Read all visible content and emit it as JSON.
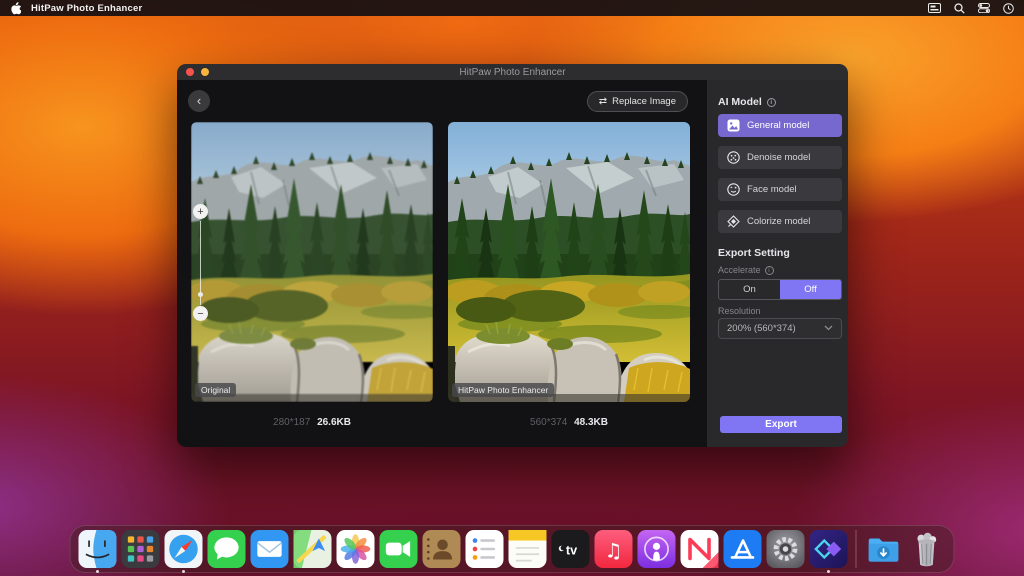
{
  "menu_bar": {
    "app_name": "HitPaw Photo Enhancer",
    "icons": [
      "apple-logo",
      "keyboard-icon",
      "search-icon",
      "control-center-icon",
      "clock-icon"
    ]
  },
  "window": {
    "title": "HitPaw Photo Enhancer",
    "toolbar": {
      "replace_image_label": "Replace Image"
    },
    "panels": {
      "original": {
        "tag": "Original",
        "dimensions": "280*187",
        "size": "26.6KB"
      },
      "enhanced": {
        "tag": "HitPaw Photo Enhancer",
        "dimensions": "560*374",
        "size": "48.3KB"
      }
    },
    "sidebar": {
      "ai_model_label": "AI Model",
      "models": [
        {
          "label": "General model",
          "icon": "picture-icon",
          "selected": true
        },
        {
          "label": "Denoise model",
          "icon": "denoise-icon",
          "selected": false
        },
        {
          "label": "Face model",
          "icon": "face-icon",
          "selected": false
        },
        {
          "label": "Colorize model",
          "icon": "colorize-icon",
          "selected": false
        }
      ],
      "export_setting_label": "Export Setting",
      "accelerate_label": "Accelerate",
      "accelerate_on": "On",
      "accelerate_off": "Off",
      "accelerate_value": "Off",
      "resolution_label": "Resolution",
      "resolution_value": "200% (560*374)",
      "export_label": "Export"
    }
  },
  "glyphs": {
    "back": "‹",
    "swap": "⇄",
    "plus": "+",
    "minus": "−",
    "info": "i"
  },
  "colors": {
    "accent_purple": "#8075f2",
    "selected_model_purple": "#7668cf",
    "sidebar_bg": "#29292c",
    "main_bg": "#121214"
  },
  "dock": {
    "items": [
      "Finder",
      "Launchpad",
      "Safari",
      "Messages",
      "Mail",
      "Maps",
      "Photos",
      "FaceTime",
      "Contacts",
      "Reminders",
      "Notes",
      "TV",
      "Music",
      "Podcasts",
      "News",
      "App Store",
      "System Settings",
      "HitPaw Photo Enhancer",
      "Downloads",
      "Trash"
    ],
    "running": [
      "Finder",
      "Safari",
      "HitPaw Photo Enhancer"
    ]
  }
}
